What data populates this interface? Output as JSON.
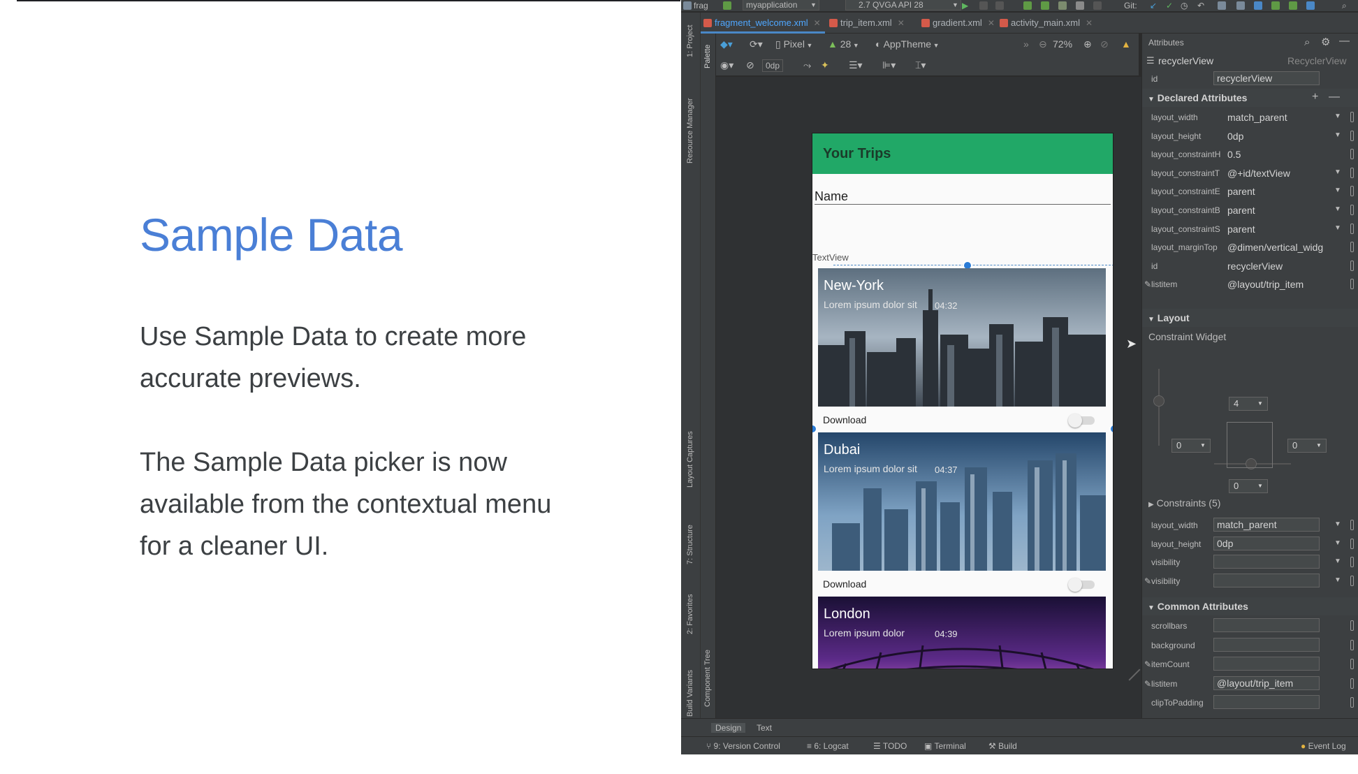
{
  "slide": {
    "title": "Sample Data",
    "paragraph1": "Use Sample Data to create more accurate previews.",
    "paragraph2": "The Sample Data picker is now available from the contextual menu for a cleaner UI."
  },
  "ide": {
    "topbar": {
      "project_fragment": "frag",
      "module": "myapplication",
      "device": "2.7  QVGA API 28",
      "git": "Git:"
    },
    "tabs": [
      "fragment_welcome.xml",
      "trip_item.xml",
      "gradient.xml",
      "activity_main.xml"
    ],
    "active_tab": 0,
    "left_tools": [
      "1: Project",
      "Resource Manager",
      "Layout Captures",
      "7: Structure",
      "2: Favorites",
      "Build Variants"
    ],
    "palette_tools": [
      "Palette",
      "Component Tree"
    ],
    "toolbar": {
      "device": "Pixel",
      "api": "28",
      "theme": "AppTheme",
      "zoom": "72%",
      "margin": "0dp"
    },
    "preview": {
      "app_title": "Your Trips",
      "name_field": "Name",
      "textview_label": "TextView",
      "download_label": "Download",
      "cards": [
        {
          "city": "New-York",
          "subtitle": "Lorem ipsum dolor sit",
          "time": "04:32"
        },
        {
          "city": "Dubai",
          "subtitle": "Lorem ipsum dolor sit",
          "time": "04:37"
        },
        {
          "city": "London",
          "subtitle": "Lorem ipsum dolor",
          "time": "04:39"
        }
      ]
    },
    "attributes": {
      "panel_title": "Attributes",
      "component": "recyclerView",
      "component_type": "RecyclerView",
      "id_label": "id",
      "id_value": "recyclerView",
      "declared_title": "Declared Attributes",
      "declared": [
        {
          "label": "layout_width",
          "value": "match_parent"
        },
        {
          "label": "layout_height",
          "value": "0dp"
        },
        {
          "label": "layout_constraintH",
          "value": "0.5"
        },
        {
          "label": "layout_constraintT",
          "value": "@+id/textView"
        },
        {
          "label": "layout_constraintE",
          "value": "parent"
        },
        {
          "label": "layout_constraintB",
          "value": "parent"
        },
        {
          "label": "layout_constraintS",
          "value": "parent"
        },
        {
          "label": "layout_marginTop",
          "value": "@dimen/vertical_widg"
        },
        {
          "label": "id",
          "value": "recyclerView"
        },
        {
          "label": "listitem",
          "value": "@layout/trip_item"
        }
      ],
      "layout_title": "Layout",
      "constraint_widget": "Constraint Widget",
      "constraint_values": {
        "top": "4",
        "left": "0",
        "right": "0",
        "bottom": "0"
      },
      "constraints_label": "Constraints (5)",
      "layout_rows": [
        {
          "label": "layout_width",
          "value": "match_parent"
        },
        {
          "label": "layout_height",
          "value": "0dp"
        },
        {
          "label": "visibility",
          "value": ""
        },
        {
          "label": "visibility",
          "value": ""
        }
      ],
      "common_title": "Common Attributes",
      "common_rows": [
        {
          "label": "scrollbars",
          "value": ""
        },
        {
          "label": "background",
          "value": ""
        },
        {
          "label": "itemCount",
          "value": ""
        },
        {
          "label": "listitem",
          "value": "@layout/trip_item"
        },
        {
          "label": "clipToPadding",
          "value": ""
        }
      ]
    },
    "bottom": {
      "design_tab": "Design",
      "text_tab": "Text",
      "version_control": "9: Version Control",
      "logcat": "6: Logcat",
      "todo": "TODO",
      "terminal": "Terminal",
      "build": "Build",
      "event_log": "Event Log"
    }
  }
}
